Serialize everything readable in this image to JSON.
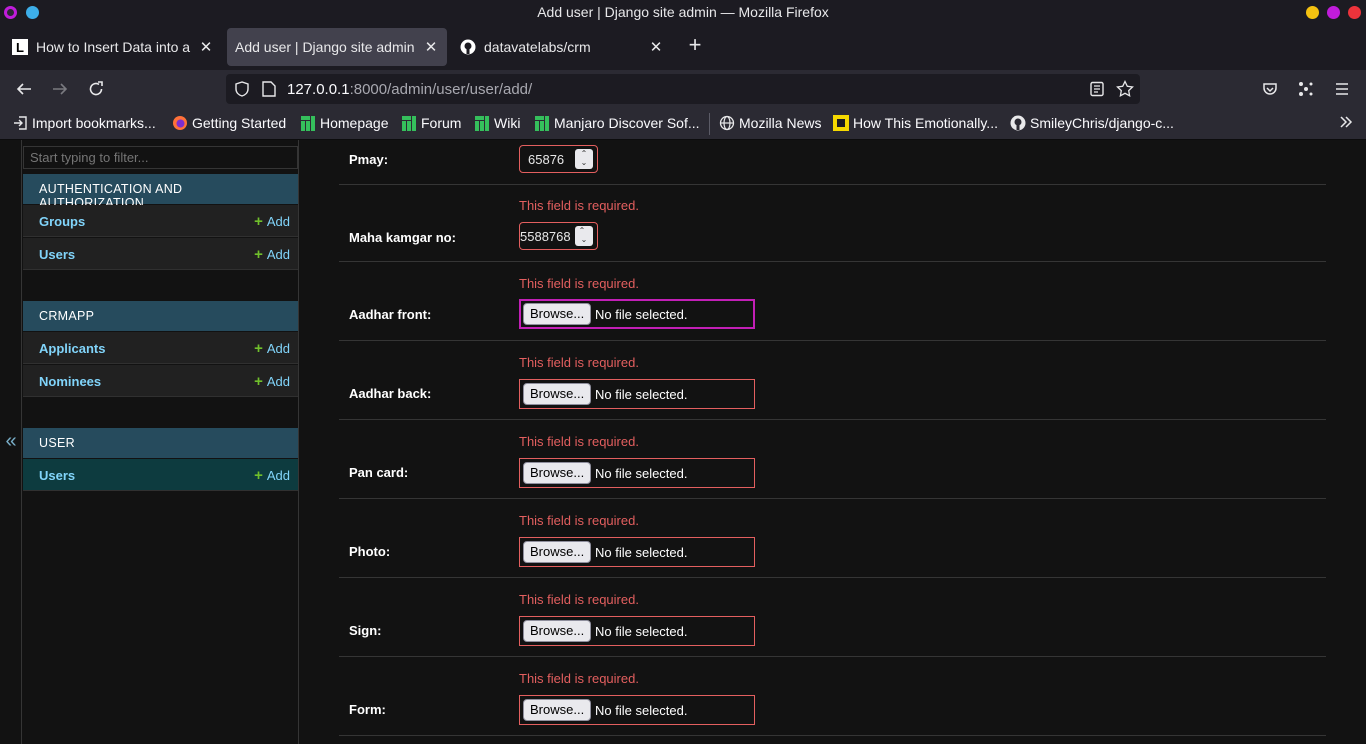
{
  "window": {
    "title": "Add user | Django site admin — Mozilla Firefox",
    "controls": {
      "minimize_color": "#f5c211",
      "maximize_color": "#c01cdb",
      "close_color": "#ed333b"
    }
  },
  "tabs": [
    {
      "label": "How to Insert Data into a D",
      "icon": "L",
      "active": false
    },
    {
      "label": "Add user | Django site admin",
      "icon": "",
      "active": true
    },
    {
      "label": "datavatelabs/crm",
      "icon": "github-icon",
      "active": false
    }
  ],
  "urlbar": {
    "host": "127.0.0.1",
    "rest": ":8000/admin/user/user/add/"
  },
  "bookmarks": [
    {
      "label": "Import bookmarks...",
      "icon": "import-icon"
    },
    {
      "label": "Getting Started",
      "icon": "firefox-icon"
    },
    {
      "label": "Homepage",
      "icon": "manjaro-icon"
    },
    {
      "label": "Forum",
      "icon": "manjaro-icon"
    },
    {
      "label": "Wiki",
      "icon": "manjaro-icon"
    },
    {
      "label": "Manjaro Discover Sof...",
      "icon": "manjaro-icon"
    },
    {
      "label": "Mozilla News",
      "icon": "globe-icon"
    },
    {
      "label": "How This Emotionally...",
      "icon": "yellow-square-icon"
    },
    {
      "label": "SmileyChris/django-c...",
      "icon": "github-icon"
    }
  ],
  "sidebar": {
    "filter_placeholder": "Start typing to filter...",
    "toggle": "«",
    "add_label": "Add",
    "modules": [
      {
        "caption": "AUTHENTICATION AND AUTHORIZATION",
        "items": [
          "Groups",
          "Users"
        ]
      },
      {
        "caption": "CRMAPP",
        "items": [
          "Applicants",
          "Nominees"
        ]
      },
      {
        "caption": "USER",
        "items": [
          "Users"
        ]
      }
    ]
  },
  "form": {
    "error_text": "This field is required.",
    "browse_label": "Browse...",
    "no_file_label": "No file selected.",
    "fields": [
      {
        "label": "Pmay:",
        "type": "number",
        "value": "65876"
      },
      {
        "label": "Maha kamgar no:",
        "type": "number",
        "value": "5588768"
      },
      {
        "label": "Aadhar front:",
        "type": "file"
      },
      {
        "label": "Aadhar back:",
        "type": "file"
      },
      {
        "label": "Pan card:",
        "type": "file"
      },
      {
        "label": "Photo:",
        "type": "file"
      },
      {
        "label": "Sign:",
        "type": "file"
      },
      {
        "label": "Form:",
        "type": "file"
      }
    ]
  },
  "colors": {
    "accent": "#79aec8",
    "error": "#e35f5f",
    "add_plus": "#70bf2b",
    "focus": "#c21fb6"
  }
}
